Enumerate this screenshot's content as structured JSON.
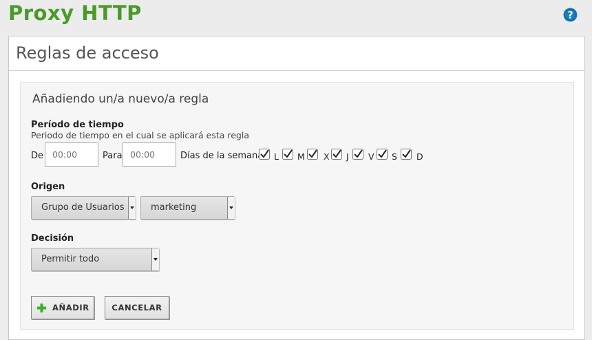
{
  "header": {
    "title": "Proxy HTTP",
    "help_icon": "help-icon"
  },
  "panel": {
    "title": "Reglas de acceso"
  },
  "form": {
    "title": "Añadiendo un/a nuevo/a regla",
    "period": {
      "label": "Período de tiempo",
      "description": "Periodo de tiempo en el cual se aplicará esta regla",
      "from_label": "De",
      "from_placeholder": "00:00",
      "to_label": "Para",
      "to_placeholder": "00:00",
      "weekdays_label": "Días de la semana",
      "days": [
        {
          "label": "L",
          "checked": true
        },
        {
          "label": "M",
          "checked": true
        },
        {
          "label": "X",
          "checked": true
        },
        {
          "label": "J",
          "checked": true
        },
        {
          "label": "V",
          "checked": true
        },
        {
          "label": "S",
          "checked": true
        },
        {
          "label": "D",
          "checked": true
        }
      ]
    },
    "origin": {
      "label": "Origen",
      "type_value": "Grupo de Usuarios",
      "group_value": "marketing"
    },
    "decision": {
      "label": "Decisión",
      "value": "Permitir todo"
    },
    "buttons": {
      "add": "AÑADIR",
      "cancel": "CANCELAR"
    }
  },
  "colors": {
    "title_green": "#4a9a2a",
    "help_blue": "#1c7fb8",
    "plus_green": "#3fae2a"
  }
}
